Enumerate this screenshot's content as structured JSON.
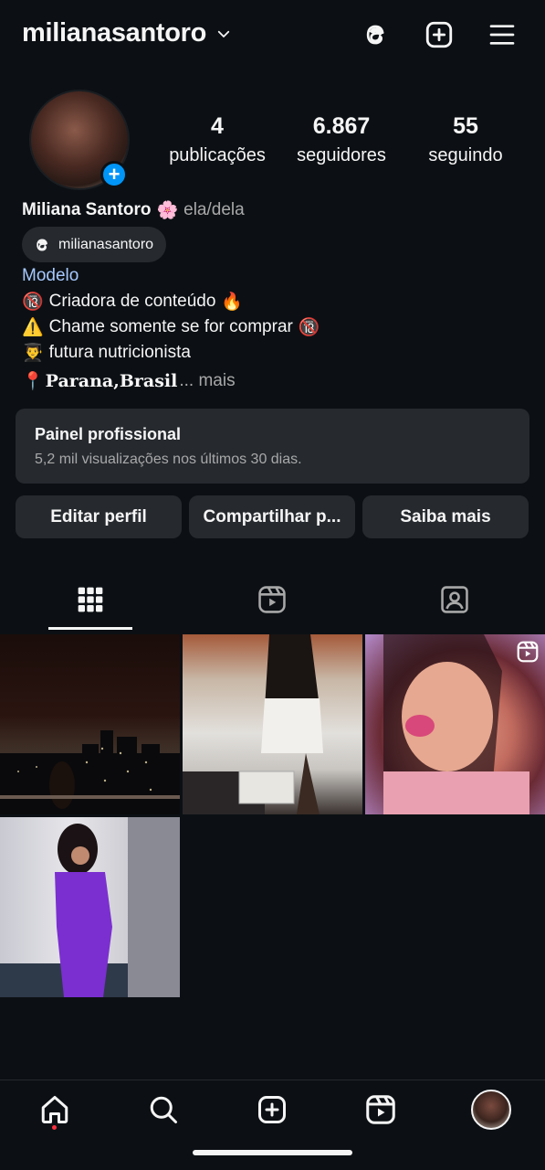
{
  "header": {
    "username": "milianasantoro",
    "icons": [
      "chevron-down-icon",
      "threads-icon",
      "new-post-icon",
      "menu-icon"
    ]
  },
  "profile": {
    "stats": [
      {
        "value": "4",
        "label": "publicações"
      },
      {
        "value": "6.867",
        "label": "seguidores"
      },
      {
        "value": "55",
        "label": "seguindo"
      }
    ],
    "full_name": "Miliana Santoro",
    "name_emoji": "🌸",
    "pronouns": "ela/dela",
    "threads_handle": "milianasantoro",
    "category": "Modelo",
    "bio": [
      {
        "emoji": "🔞",
        "text": "Criadora de conteúdo",
        "suffix": "🔥"
      },
      {
        "emoji": "⚠️",
        "text": "Chame somente se for comprar",
        "suffix": "🔞"
      },
      {
        "emoji": "👨‍🎓",
        "text": "futura nutricionista",
        "suffix": ""
      }
    ],
    "location_emoji": "📍",
    "location": "Parana,Brasil",
    "more_label": "... mais"
  },
  "dashboard": {
    "title": "Painel profissional",
    "subtitle": "5,2 mil visualizações nos últimos 30 dias."
  },
  "buttons": {
    "edit": "Editar perfil",
    "share": "Compartilhar p...",
    "learn": "Saiba mais"
  },
  "tabs": [
    "grid-icon",
    "reels-icon",
    "tagged-icon"
  ],
  "posts": [
    {
      "kind": "photo"
    },
    {
      "kind": "photo"
    },
    {
      "kind": "reel"
    },
    {
      "kind": "photo"
    }
  ],
  "nav": [
    "home-icon",
    "search-icon",
    "create-icon",
    "reels-icon",
    "profile-avatar"
  ],
  "colors": {
    "background": "#0c1014",
    "surface": "#262a2f",
    "accent": "#0095f6",
    "link": "#a6c8ff",
    "notification": "#ff3040"
  }
}
